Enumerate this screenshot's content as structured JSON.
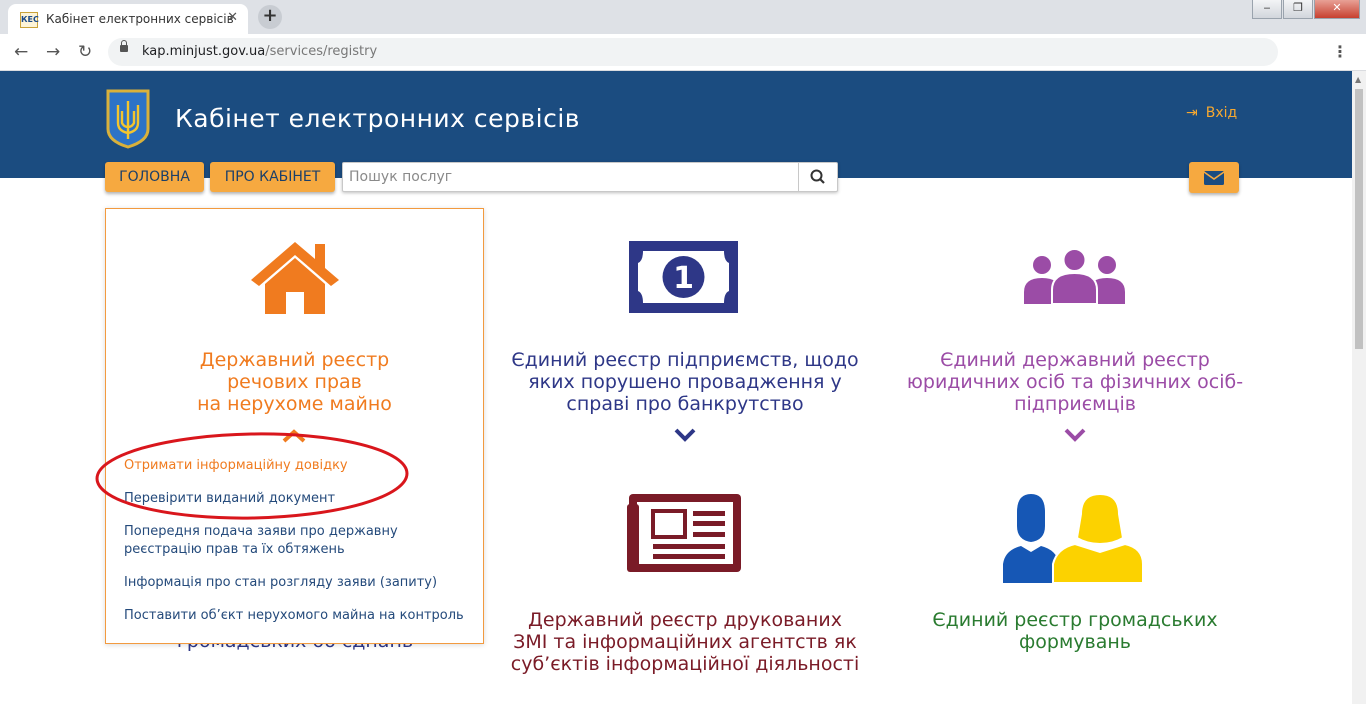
{
  "browser": {
    "tab_title": "Кабінет електронних сервісів",
    "tab_close": "✕",
    "new_tab": "+",
    "url_host": "kap.minjust.gov.ua",
    "url_path": "/services/registry",
    "back": "←",
    "forward": "→",
    "reload": "↻",
    "menu": "⋮",
    "favicon_text": "КЕС"
  },
  "header": {
    "title": "Кабінет електронних сервісів",
    "login": "Вхід",
    "login_icon": "sign-in-icon",
    "nav": {
      "home": "ГОЛОВНА",
      "about": "ПРО КАБІНЕТ"
    },
    "search_placeholder": "Пошук послуг",
    "colors": {
      "bar": "#1b4c80",
      "accent": "#f6a940"
    }
  },
  "services": [
    {
      "title": "Державний реєстр\nречових прав\nна нерухоме майно",
      "color": "#f07b1f",
      "icon": "house-icon"
    },
    {
      "title": "Єдиний реєстр підприємств, щодо\nяких порушено провадження у\nсправі про банкрутство",
      "color": "#2e3787",
      "icon": "banknote-icon"
    },
    {
      "title": "Єдиний державний реєстр\nюридичних осіб та фізичних осіб-\nпідприємців",
      "color": "#9b4ca6",
      "icon": "people-group-icon"
    },
    {
      "title": "Державний реєстр друкованих\nЗМІ та інформаційних агентств як\nсуб’єктів інформаційної діяльності",
      "color": "#7a1b27",
      "icon": "newspaper-icon"
    },
    {
      "title": "Єдиний реєстр громадських\nформувань",
      "color": "#2a7b30",
      "icon": "two-persons-icon"
    }
  ],
  "hidden_partial": "громадських об’єднань",
  "dropdown_links": [
    "Отримати інформаційну довідку",
    "Перевірити виданий документ",
    "Попередня подача заяви про державну\nреєстрацію прав та їх обтяжень",
    "Інформація про стан розгляду заяви (запиту)",
    "Поставити об’єкт нерухомого майна на контроль"
  ]
}
